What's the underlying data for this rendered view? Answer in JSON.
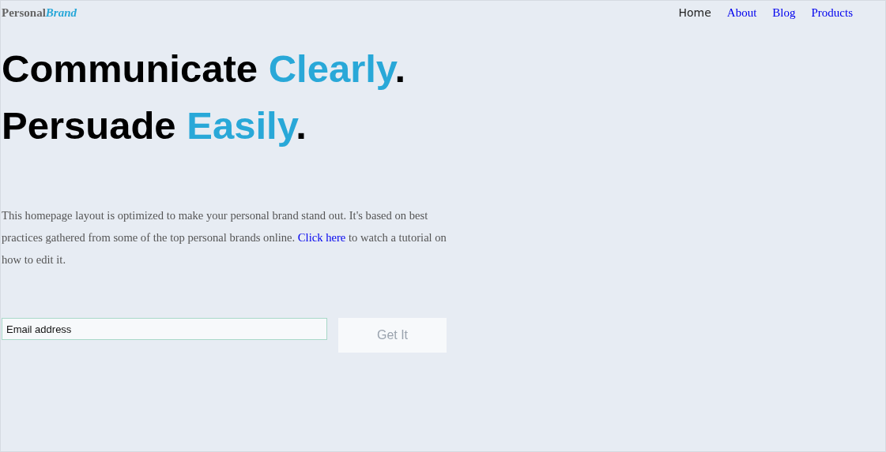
{
  "logo": {
    "plain": "Personal",
    "accent": "Brand"
  },
  "nav": [
    {
      "label": "Home",
      "selected": true
    },
    {
      "label": "About",
      "selected": false
    },
    {
      "label": "Blog",
      "selected": false
    },
    {
      "label": "Products",
      "selected": false
    }
  ],
  "headline": [
    {
      "lead": "Communicate ",
      "accent": "Clearly",
      "end": "."
    },
    {
      "lead": "Persuade ",
      "accent": "Easily",
      "end": "."
    }
  ],
  "intro": {
    "before": "This homepage layout is optimized to make your personal brand stand out. It's based on best practices gathered from some of the top personal brands online. ",
    "link": "Click here",
    "after": " to watch a tutorial on how to edit it."
  },
  "signup": {
    "placeholder": "Email address",
    "button": "Get It"
  }
}
